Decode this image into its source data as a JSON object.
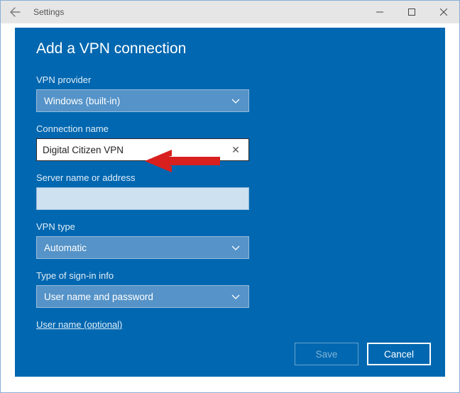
{
  "titlebar": {
    "title": "Settings"
  },
  "dialog": {
    "heading": "Add a VPN connection"
  },
  "fields": {
    "provider": {
      "label": "VPN provider",
      "value": "Windows (built-in)"
    },
    "connection_name": {
      "label": "Connection name",
      "value": "Digital Citizen VPN"
    },
    "server": {
      "label": "Server name or address",
      "value": ""
    },
    "vpn_type": {
      "label": "VPN type",
      "value": "Automatic"
    },
    "signin": {
      "label": "Type of sign-in info",
      "value": "User name and password"
    },
    "username": {
      "label": "User name (optional)",
      "value": ""
    }
  },
  "buttons": {
    "save": "Save",
    "cancel": "Cancel"
  }
}
